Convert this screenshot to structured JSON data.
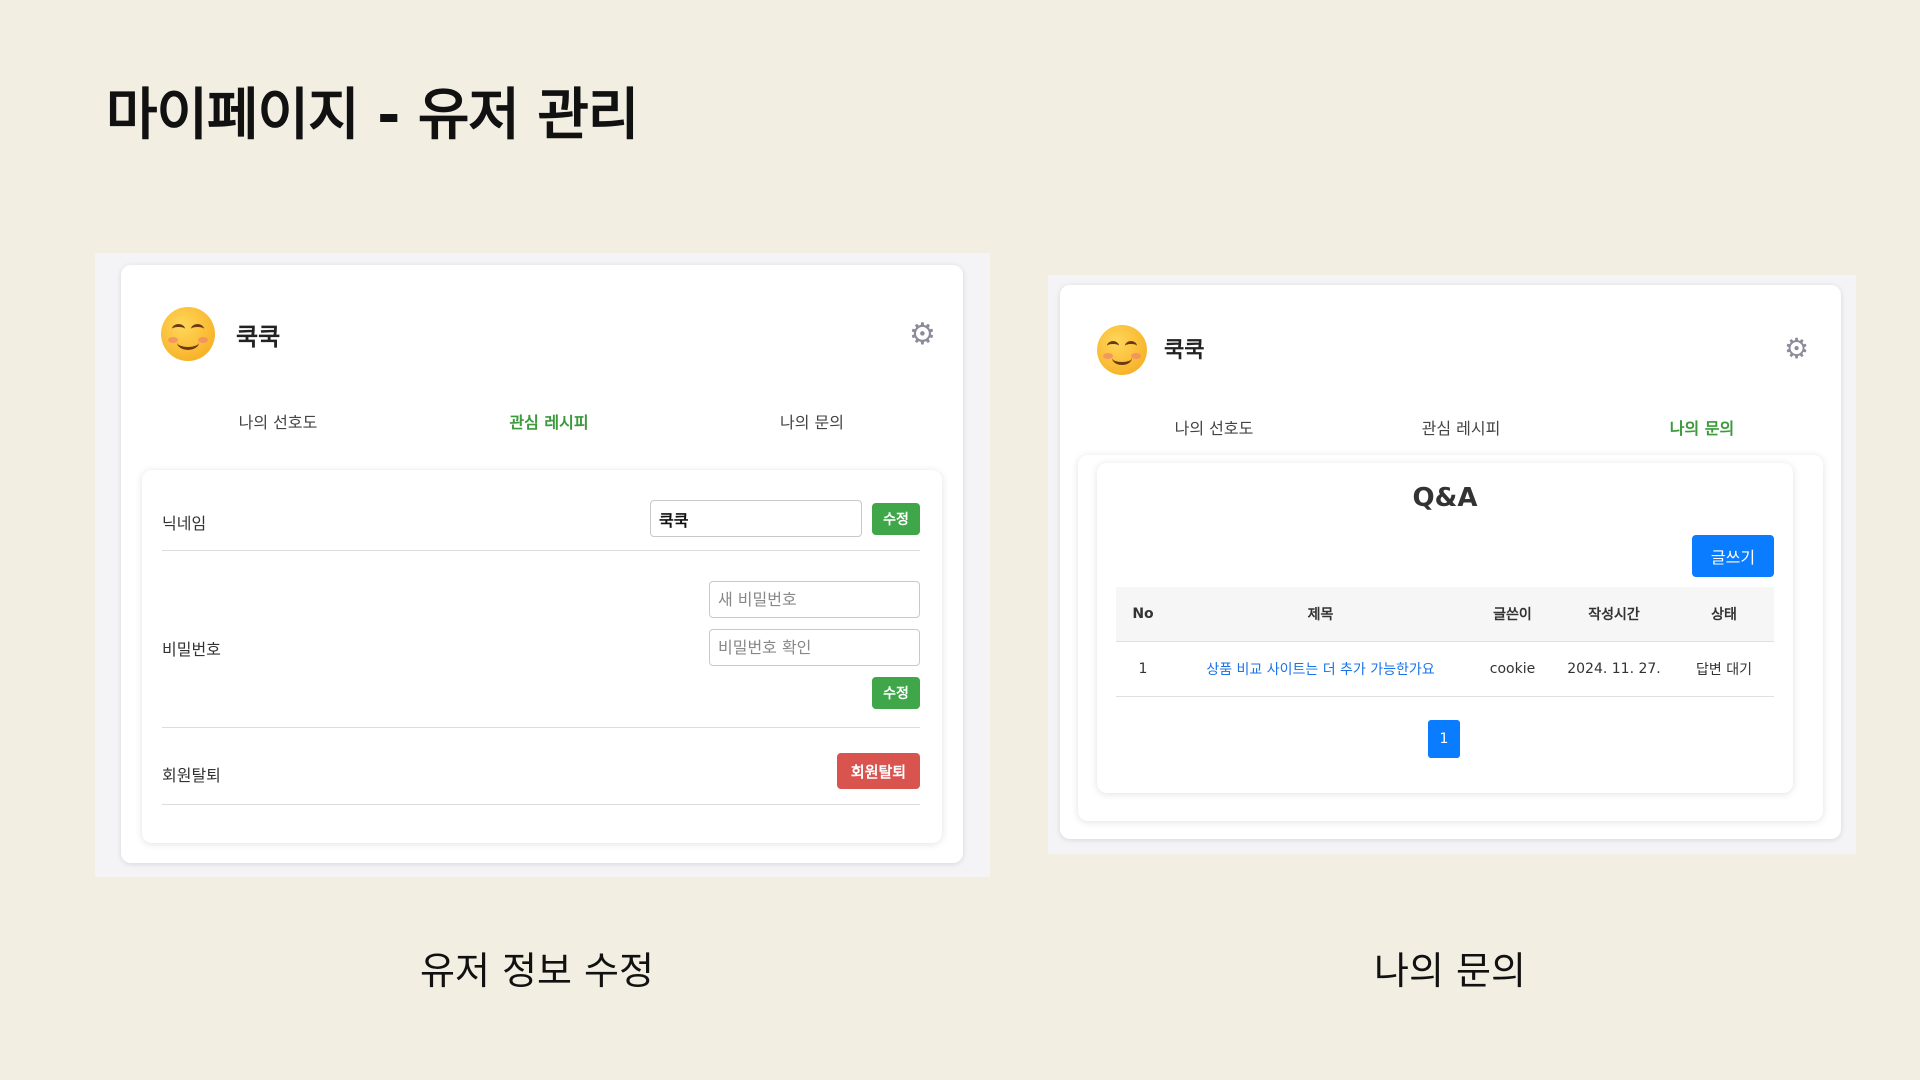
{
  "slide": {
    "title": "마이페이지 - 유저 관리",
    "caption_left": "유저 정보 수정",
    "caption_right": "나의 문의"
  },
  "colors": {
    "background": "#f2efe2",
    "active_tab": "#3c9a3c",
    "green_button": "#3fa64a",
    "red_button": "#d9534f",
    "blue_button": "#0a7cff",
    "link": "#1a73e8"
  },
  "edit_screen": {
    "username": "쿡쿡",
    "avatar_icon": "smiling-face-emoji",
    "settings_icon": "gear-icon",
    "tabs": [
      {
        "label": "나의 선호도",
        "active": false
      },
      {
        "label": "관심 레시피",
        "active": true
      },
      {
        "label": "나의 문의",
        "active": false
      }
    ],
    "nickname": {
      "label": "닉네임",
      "value": "쿡쿡",
      "button": "수정"
    },
    "password": {
      "label": "비밀번호",
      "new_placeholder": "새 비밀번호",
      "confirm_placeholder": "비밀번호 확인",
      "button": "수정"
    },
    "withdraw": {
      "label": "회원탈퇴",
      "button": "회원탈퇴"
    }
  },
  "inquiry_screen": {
    "username": "쿡쿡",
    "avatar_icon": "smiling-face-emoji",
    "settings_icon": "gear-icon",
    "tabs": [
      {
        "label": "나의 선호도",
        "active": false
      },
      {
        "label": "관심 레시피",
        "active": false
      },
      {
        "label": "나의 문의",
        "active": true
      }
    ],
    "qa_title": "Q&A",
    "write_button": "글쓰기",
    "columns": [
      "No",
      "제목",
      "글쓴이",
      "작성시간",
      "상태"
    ],
    "rows": [
      {
        "no": "1",
        "title": "상품 비교 사이트는 더 추가 가능한가요",
        "author": "cookie",
        "date": "2024. 11. 27.",
        "status": "답변 대기"
      }
    ],
    "pagination": {
      "current": "1"
    }
  }
}
